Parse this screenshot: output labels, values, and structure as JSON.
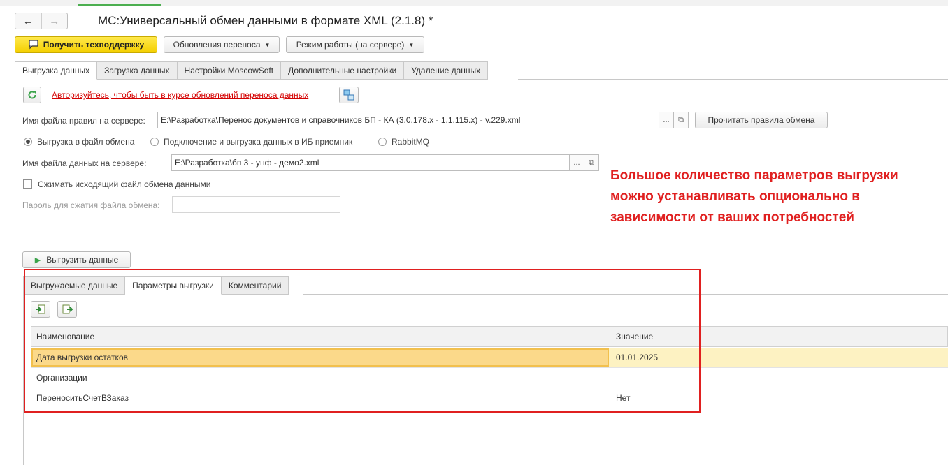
{
  "window": {
    "title": "МС:Универсальный обмен данными в формате XML (2.1.8) *",
    "nav_back": "←",
    "nav_forward": "→"
  },
  "toolbar": {
    "support_button": "Получить техподдержку",
    "updates_button": "Обновления переноса",
    "mode_button": "Режим работы (на сервере)"
  },
  "main_tabs": [
    {
      "label": "Выгрузка данных",
      "active": true
    },
    {
      "label": "Загрузка данных",
      "active": false
    },
    {
      "label": "Настройки MoscowSoft",
      "active": false
    },
    {
      "label": "Дополнительные настройки",
      "active": false
    },
    {
      "label": "Удаление данных",
      "active": false
    }
  ],
  "export": {
    "auth_link": "Авторизуйтесь, чтобы быть в курсе обновлений переноса данных",
    "rules_file_label": "Имя файла правил на сервере:",
    "rules_file_value": "E:\\Разработка\\Перенос документов и справочников БП - КА (3.0.178.x - 1.1.115.x) - v.229.xml",
    "read_rules_button": "Прочитать правила обмена",
    "radio_options": [
      {
        "label": "Выгрузка в файл обмена",
        "selected": true
      },
      {
        "label": "Подключение и выгрузка данных в ИБ приемник",
        "selected": false
      },
      {
        "label": "RabbitMQ",
        "selected": false
      }
    ],
    "data_file_label": "Имя файла данных на сервере:",
    "data_file_value": "E:\\Разработка\\бп 3 - унф - демо2.xml",
    "compress_label": "Сжимать исходящий файл обмена данными",
    "compress_checked": false,
    "password_label": "Пароль для сжатия файла обмена:",
    "password_value": "",
    "export_button": "Выгрузить данные",
    "ellipsis": "...",
    "open_glyph": "⧉"
  },
  "annotation": {
    "text": "Большое количество параметров выгрузки можно устанавливать опционально в зависимости от ваших потребностей",
    "color": "#e02020"
  },
  "sub_tabs": [
    {
      "label": "Выгружаемые данные",
      "active": false
    },
    {
      "label": "Параметры выгрузки",
      "active": true
    },
    {
      "label": "Комментарий",
      "active": false
    }
  ],
  "params_table": {
    "columns": [
      "Наименование",
      "Значение"
    ],
    "rows": [
      {
        "name": "Дата выгрузки остатков",
        "value": "01.01.2025",
        "selected": true
      },
      {
        "name": "Организации",
        "value": "",
        "selected": false
      },
      {
        "name": "ПереноситьСчетВЗаказ",
        "value": "Нет",
        "selected": false
      }
    ]
  },
  "colors": {
    "accent_yellow": "#f4cf00",
    "selected_row": "#fdf2c2",
    "link_red": "#d40000",
    "refresh_green": "#3aa34a"
  }
}
